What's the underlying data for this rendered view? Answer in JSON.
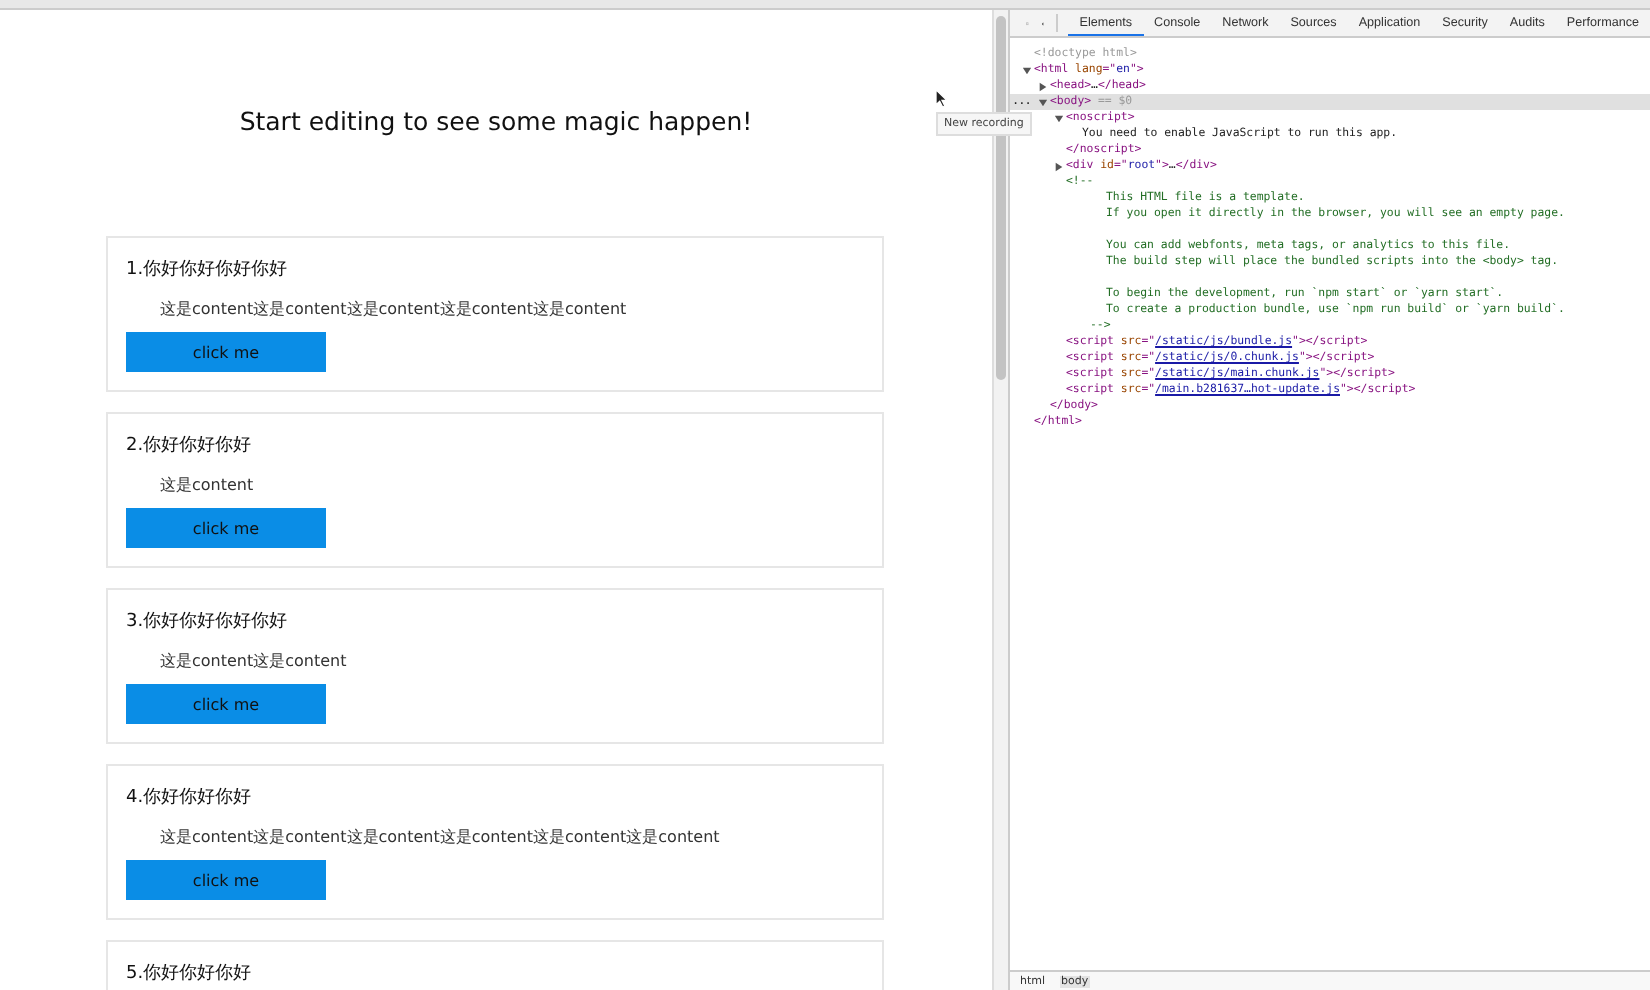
{
  "page": {
    "heading": "Start editing to see some magic happen!",
    "cards": [
      {
        "title": "1.你好你好你好你好",
        "content": "这是content这是content这是content这是content这是content",
        "button": "click me"
      },
      {
        "title": "2.你好你好你好",
        "content": "这是content",
        "button": "click me"
      },
      {
        "title": "3.你好你好你好你好",
        "content": "这是content这是content",
        "button": "click me"
      },
      {
        "title": "4.你好你好你好",
        "content": "这是content这是content这是content这是content这是content这是content",
        "button": "click me"
      },
      {
        "title": "5.你好你好你好"
      }
    ]
  },
  "tooltip": "New recording",
  "devtools": {
    "tabs": [
      {
        "label": "Elements",
        "selected": true
      },
      {
        "label": "Console",
        "selected": false
      },
      {
        "label": "Network",
        "selected": false
      },
      {
        "label": "Sources",
        "selected": false
      },
      {
        "label": "Application",
        "selected": false
      },
      {
        "label": "Security",
        "selected": false
      },
      {
        "label": "Audits",
        "selected": false
      },
      {
        "label": "Performance",
        "selected": false
      }
    ],
    "dom": [
      {
        "kind": "line",
        "open": [
          {
            "kind": "dim",
            "text": "<!doctype html>"
          }
        ]
      },
      {
        "kind": "element",
        "selected": false,
        "expanded": true,
        "open": [
          {
            "kind": "tag",
            "text": "<html "
          },
          {
            "kind": "attr",
            "text": "lang"
          },
          {
            "kind": "tag",
            "text": "=\""
          },
          {
            "kind": "val",
            "text": "en"
          },
          {
            "kind": "tag",
            "text": "\">"
          }
        ],
        "close": [
          {
            "kind": "tag",
            "text": "</html>"
          }
        ],
        "children": [
          {
            "kind": "element",
            "selected": false,
            "expanded": false,
            "open": [
              {
                "kind": "tag",
                "text": "<head>"
              },
              {
                "kind": "text",
                "text": "…"
              },
              {
                "kind": "tag",
                "text": "</head>"
              }
            ]
          },
          {
            "kind": "element",
            "selected": true,
            "expanded": true,
            "marker": "...",
            "open": [
              {
                "kind": "tag",
                "text": "<body>"
              },
              {
                "kind": "dim",
                "text": " == $0"
              }
            ],
            "close": [
              {
                "kind": "tag",
                "text": "</body>"
              }
            ],
            "children": [
              {
                "kind": "element",
                "selected": false,
                "expanded": true,
                "open": [
                  {
                    "kind": "tag",
                    "text": "<noscript>"
                  }
                ],
                "close": [
                  {
                    "kind": "tag",
                    "text": "</noscript>"
                  }
                ],
                "children": [
                  {
                    "kind": "line",
                    "open": [
                      {
                        "kind": "text",
                        "text": "You need to enable JavaScript to run this app."
                      }
                    ]
                  }
                ]
              },
              {
                "kind": "element",
                "selected": false,
                "expanded": false,
                "open": [
                  {
                    "kind": "tag",
                    "text": "<div "
                  },
                  {
                    "kind": "attr",
                    "text": "id"
                  },
                  {
                    "kind": "tag",
                    "text": "=\""
                  },
                  {
                    "kind": "val",
                    "text": "root"
                  },
                  {
                    "kind": "tag",
                    "text": "\">"
                  },
                  {
                    "kind": "text",
                    "text": "…"
                  },
                  {
                    "kind": "tag",
                    "text": "</div>"
                  }
                ]
              },
              {
                "kind": "comment",
                "open": [
                  {
                    "kind": "comment",
                    "text": "<!--"
                  }
                ],
                "close": [
                  {
                    "kind": "comment",
                    "text": "-->"
                  }
                ],
                "paragraphs": [
                  [
                    "This HTML file is a template.",
                    "If you open it directly in the browser, you will see an empty page."
                  ],
                  [
                    "You can add webfonts, meta tags, or analytics to this file.",
                    "The build step will place the bundled scripts into the <body> tag."
                  ],
                  [
                    "To begin the development, run `npm start` or `yarn start`.",
                    "To create a production bundle, use `npm run build` or `yarn build`."
                  ]
                ]
              },
              {
                "kind": "line",
                "open": [
                  {
                    "kind": "tag",
                    "text": "<script "
                  },
                  {
                    "kind": "attr",
                    "text": "src"
                  },
                  {
                    "kind": "tag",
                    "text": "=\""
                  },
                  {
                    "kind": "link",
                    "text": "/static/js/bundle.js"
                  },
                  {
                    "kind": "tag",
                    "text": "\"></script>"
                  }
                ]
              },
              {
                "kind": "line",
                "open": [
                  {
                    "kind": "tag",
                    "text": "<script "
                  },
                  {
                    "kind": "attr",
                    "text": "src"
                  },
                  {
                    "kind": "tag",
                    "text": "=\""
                  },
                  {
                    "kind": "link",
                    "text": "/static/js/0.chunk.js"
                  },
                  {
                    "kind": "tag",
                    "text": "\"></script>"
                  }
                ]
              },
              {
                "kind": "line",
                "open": [
                  {
                    "kind": "tag",
                    "text": "<script "
                  },
                  {
                    "kind": "attr",
                    "text": "src"
                  },
                  {
                    "kind": "tag",
                    "text": "=\""
                  },
                  {
                    "kind": "link",
                    "text": "/static/js/main.chunk.js"
                  },
                  {
                    "kind": "tag",
                    "text": "\"></script>"
                  }
                ]
              },
              {
                "kind": "line",
                "open": [
                  {
                    "kind": "tag",
                    "text": "<script "
                  },
                  {
                    "kind": "attr",
                    "text": "src"
                  },
                  {
                    "kind": "tag",
                    "text": "=\""
                  },
                  {
                    "kind": "link",
                    "text": "/main.b281637…hot-update.js"
                  },
                  {
                    "kind": "tag",
                    "text": "\"></script>"
                  }
                ]
              }
            ]
          }
        ]
      }
    ],
    "breadcrumbs": [
      {
        "label": "html",
        "selected": false
      },
      {
        "label": "body",
        "selected": true
      }
    ]
  }
}
